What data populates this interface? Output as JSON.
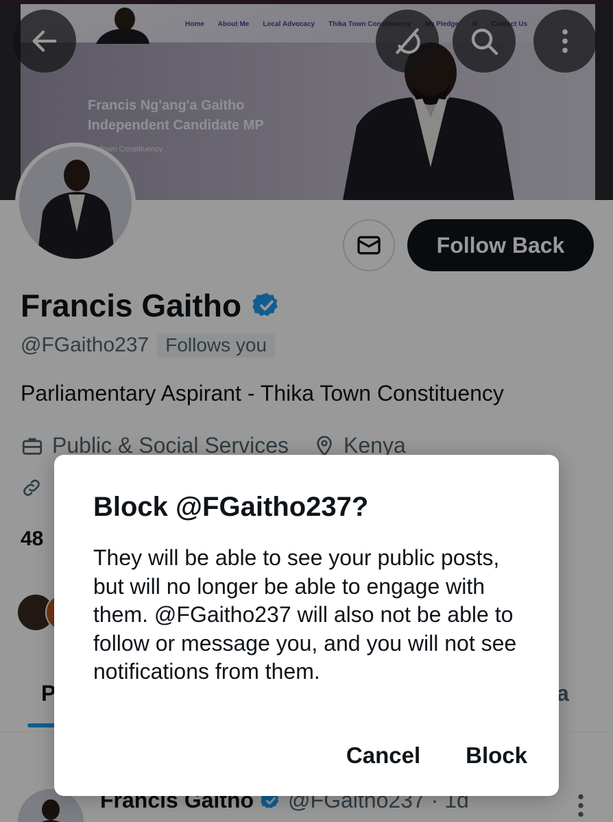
{
  "banner": {
    "site_nav": [
      "Home",
      "About Me",
      "Local Advocacy",
      "Thika Town Constituency",
      "My Pledge",
      "N",
      "Contact Us"
    ],
    "headline_line1": "Francis Ng'ang'a Gaitho",
    "headline_line2": "Independent Candidate MP",
    "subline": "ika Town Constituency"
  },
  "toolbar": {
    "back_icon": "arrow-left-icon",
    "grok_icon": "grok-icon",
    "search_icon": "search-icon",
    "more_icon": "more-vertical-icon"
  },
  "profile": {
    "follow_back_label": "Follow Back",
    "name": "Francis Gaitho",
    "verified": true,
    "handle": "@FGaitho237",
    "follows_you": "Follows you",
    "bio": "Parliamentary Aspirant - Thika Town Constituency",
    "category": "Public & Social Services",
    "location": "Kenya",
    "stats_partial": "48",
    "accent_color": "#1d9bf0"
  },
  "tabs": {
    "first_partial": "P",
    "last_partial": "a"
  },
  "post": {
    "author": "Francis Gaitho",
    "handle_time": "@FGaitho237 · 1d"
  },
  "dialog": {
    "title": "Block @FGaitho237?",
    "body": "They will be able to see your public posts, but will no longer be able to engage with them. @FGaitho237 will also not be able to follow or message you, and you will not see notifications from them.",
    "cancel_label": "Cancel",
    "confirm_label": "Block"
  }
}
